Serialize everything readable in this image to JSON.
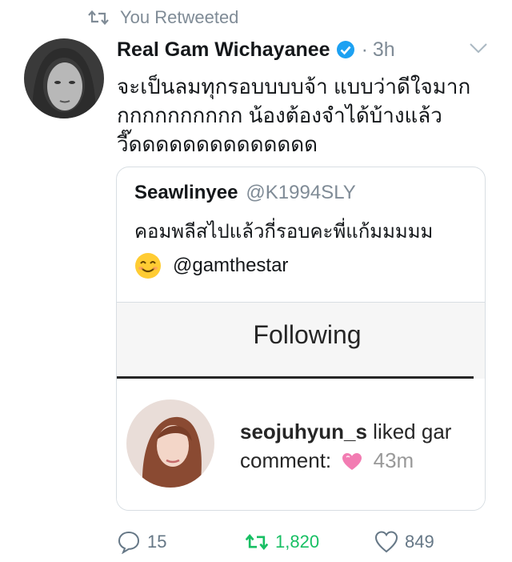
{
  "retweet_banner": {
    "text": "You Retweeted"
  },
  "tweet": {
    "author_name": "Real Gam Wichayanee",
    "separator": "·",
    "time": "3h",
    "text": "จะเป็นลมทุกรอบบบบจ้า แบบว่าดีใจมาก\nกกกกกกกกกก น้องต้องจำได้บ้างแล้ว\nวี๊ดดดดดดดดดดดดดด"
  },
  "quote": {
    "author_name": "Seawlinyee",
    "author_handle": "@K1994SLY",
    "text": "คอมพลีสไปแล้วกี่รอบคะพี่แก้มมมมม",
    "mention": "@gamthestar",
    "screenshot": {
      "title": "Following",
      "notif_user": "seojuhyun_s",
      "notif_action": " liked gar",
      "notif_line2": "comment:",
      "notif_time": "43m"
    }
  },
  "actions": {
    "reply_count": "15",
    "retweet_count": "1,820",
    "like_count": "849"
  },
  "colors": {
    "retweet_green": "#17bf63",
    "gray_text": "#7f8b96",
    "verified_blue": "#1da1f2",
    "border": "#d8dee3"
  },
  "icons": [
    "retweet-icon",
    "verified-badge-icon",
    "chevron-down-icon",
    "smiling-face-emoji-icon",
    "pink-heart-emoji-icon",
    "reply-icon",
    "like-icon"
  ]
}
